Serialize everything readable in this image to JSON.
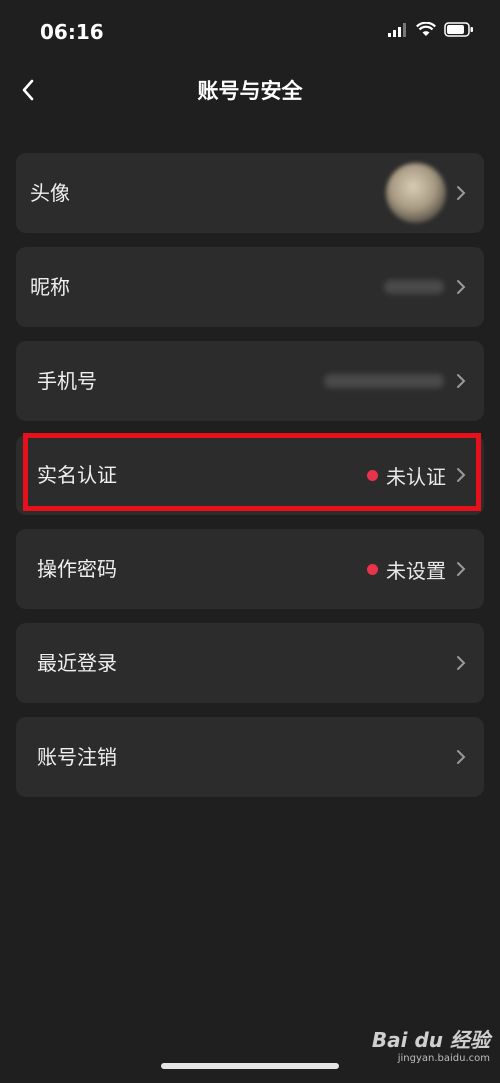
{
  "status_bar": {
    "time": "06:16",
    "icons": [
      "signal-icon",
      "wifi-icon",
      "battery-icon"
    ]
  },
  "header": {
    "title": "账号与安全",
    "back_icon": "chevron-left-icon"
  },
  "menu": [
    {
      "label": "头像",
      "value": "",
      "dot": false,
      "kind": "avatar"
    },
    {
      "label": "昵称",
      "value": "",
      "dot": false,
      "kind": "blurred"
    },
    {
      "label": "手机号",
      "value": "",
      "dot": false,
      "kind": "blurred"
    },
    {
      "label": "实名认证",
      "value": "未认证",
      "dot": true,
      "kind": "status"
    },
    {
      "label": "操作密码",
      "value": "未设置",
      "dot": true,
      "kind": "status"
    },
    {
      "label": "最近登录",
      "value": "",
      "dot": false,
      "kind": "plain"
    },
    {
      "label": "账号注销",
      "value": "",
      "dot": false,
      "kind": "plain"
    }
  ],
  "colors": {
    "background": "#1f1f1f",
    "card": "#2c2c2c",
    "status_dot": "#e8344a",
    "highlight_box": "#e8101a"
  },
  "watermark": {
    "logo": "Bai du 经验",
    "url": "jingyan.baidu.com"
  }
}
